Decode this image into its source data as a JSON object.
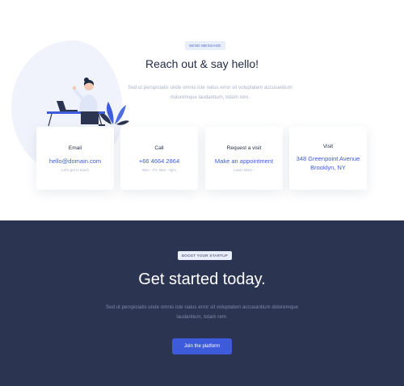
{
  "contact": {
    "badge": "Send message",
    "title": "Reach out & say hello!",
    "description": "Sed ut perspiciatis unde omnis iste natus error sit voluptatem accusantium doloremque laudantium, totam rem.",
    "cards": [
      {
        "title": "Email",
        "value": "hello@domain.com",
        "sub": "Let's get in touch"
      },
      {
        "title": "Call",
        "value": "+66 4664 2864",
        "sub": "Mon - Fri, 9am - 5pm"
      },
      {
        "title": "Request a visit",
        "value": "Make an appointment",
        "sub": "Learn More ›"
      },
      {
        "title": "Visit",
        "value": "348 Greenpoint Avenue Brooklyn, NY",
        "sub": ""
      }
    ]
  },
  "cta_section": {
    "badge": "Boost your startup",
    "title": "Get started today.",
    "description": "Sed ut perspiciatis unde omnis iste natus error sit voluptatem accusantium doloremque laudantium, totam rem.",
    "button_label": "Join the platform"
  },
  "colors": {
    "accent": "#3d5bdb",
    "dark_bg": "#2b3552",
    "link": "#3f5bd3"
  }
}
